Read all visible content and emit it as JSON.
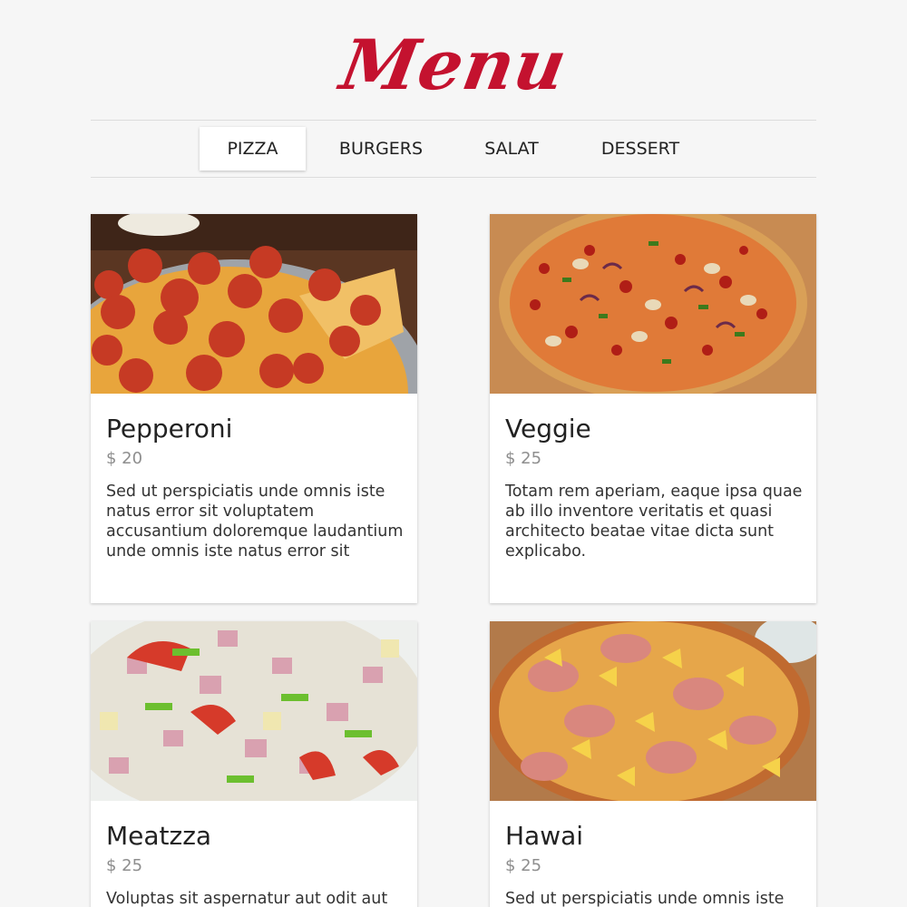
{
  "header": {
    "title": "Menu"
  },
  "nav": {
    "tabs": [
      {
        "label": "PIZZA",
        "active": true
      },
      {
        "label": "BURGERS",
        "active": false
      },
      {
        "label": "SALAT",
        "active": false
      },
      {
        "label": "DESSERT",
        "active": false
      }
    ]
  },
  "colors": {
    "accent": "#c4122f",
    "background": "#f6f6f6",
    "card": "#ffffff",
    "price": "#8e8e8e"
  },
  "items": [
    {
      "name": "Pepperoni",
      "price": "$ 20",
      "description": "Sed ut perspiciatis unde omnis iste natus error sit voluptatem accusantium doloremque laudantium unde omnis iste natus error sit",
      "image": "pepperoni-pizza-photo"
    },
    {
      "name": "Veggie",
      "price": "$ 25",
      "description": "Totam rem aperiam, eaque ipsa quae ab illo inventore veritatis et quasi architecto beatae vitae dicta sunt explicabo.",
      "image": "veggie-pizza-photo"
    },
    {
      "name": "Meatzza",
      "price": "$ 25",
      "description": "Voluptas sit aspernatur aut odit aut",
      "image": "ham-salad-photo"
    },
    {
      "name": "Hawai",
      "price": "$ 25",
      "description": "Sed ut perspiciatis unde omnis iste",
      "image": "hawaiian-pizza-photo"
    }
  ]
}
